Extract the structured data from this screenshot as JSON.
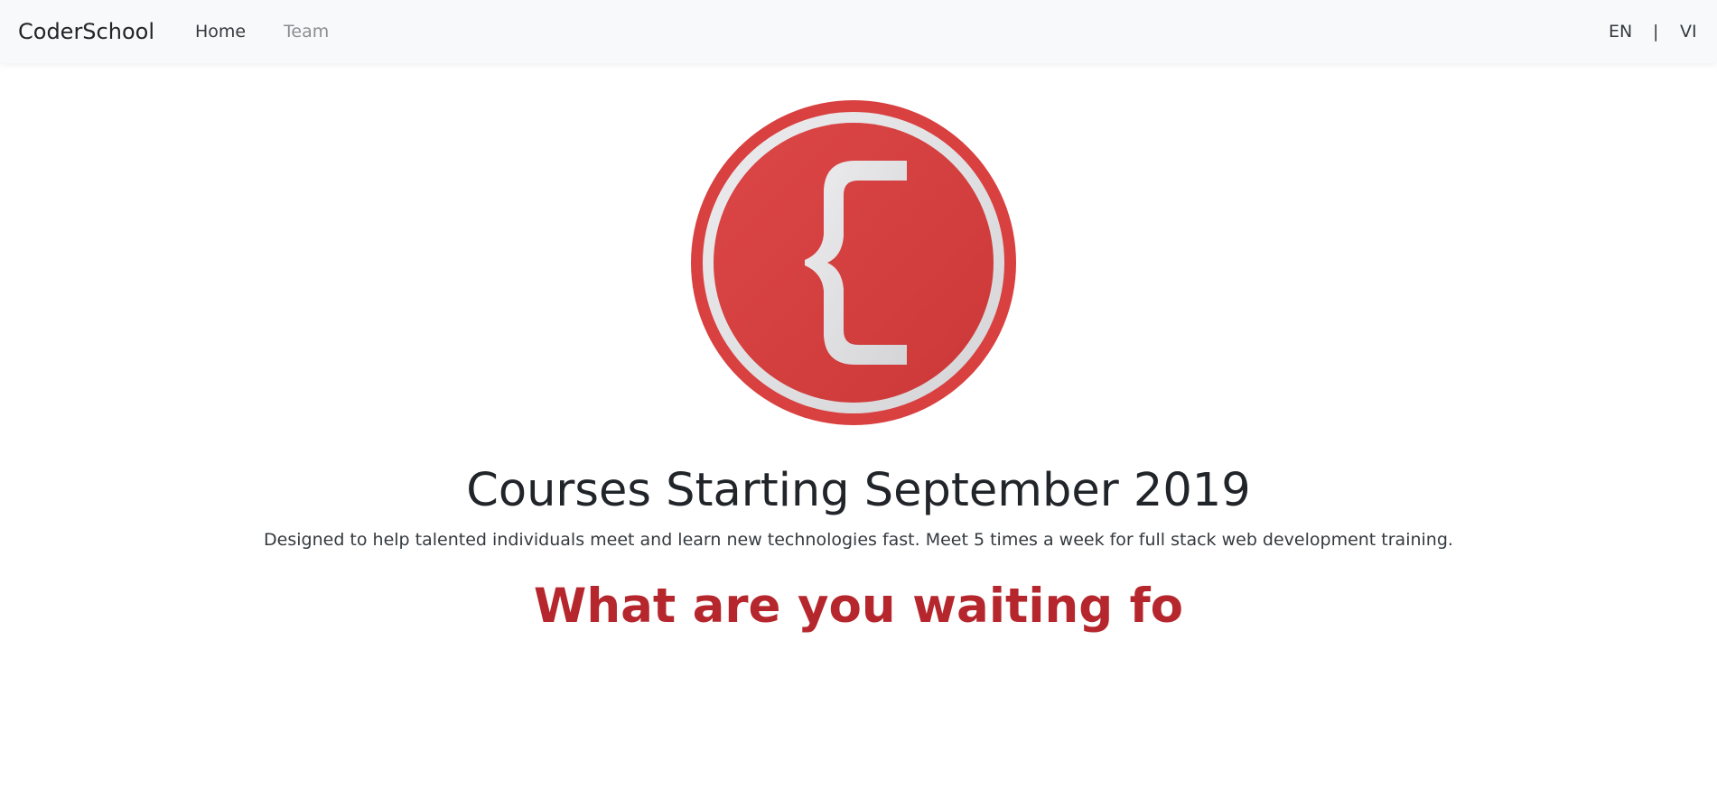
{
  "navbar": {
    "brand": "CoderSchool",
    "links": [
      {
        "label": "Home"
      },
      {
        "label": "Team"
      }
    ],
    "language": {
      "en": "EN",
      "separator": "|",
      "vi": "VI"
    }
  },
  "hero": {
    "logo_icon": "curly-brace-logo",
    "title": "Courses Starting September 2019",
    "description": "Designed to help talented individuals meet and learn new technologies fast. Meet 5 times a week for full stack web development training.",
    "call_to_action": "What are you waiting fo"
  },
  "colors": {
    "navbar_bg": "#f8f9fa",
    "logo_red": "#d63f3f",
    "logo_ring": "#e6e6e8",
    "cta_red": "#b5272d",
    "text_dark": "#212529",
    "muted_link": "#8a8f94"
  }
}
